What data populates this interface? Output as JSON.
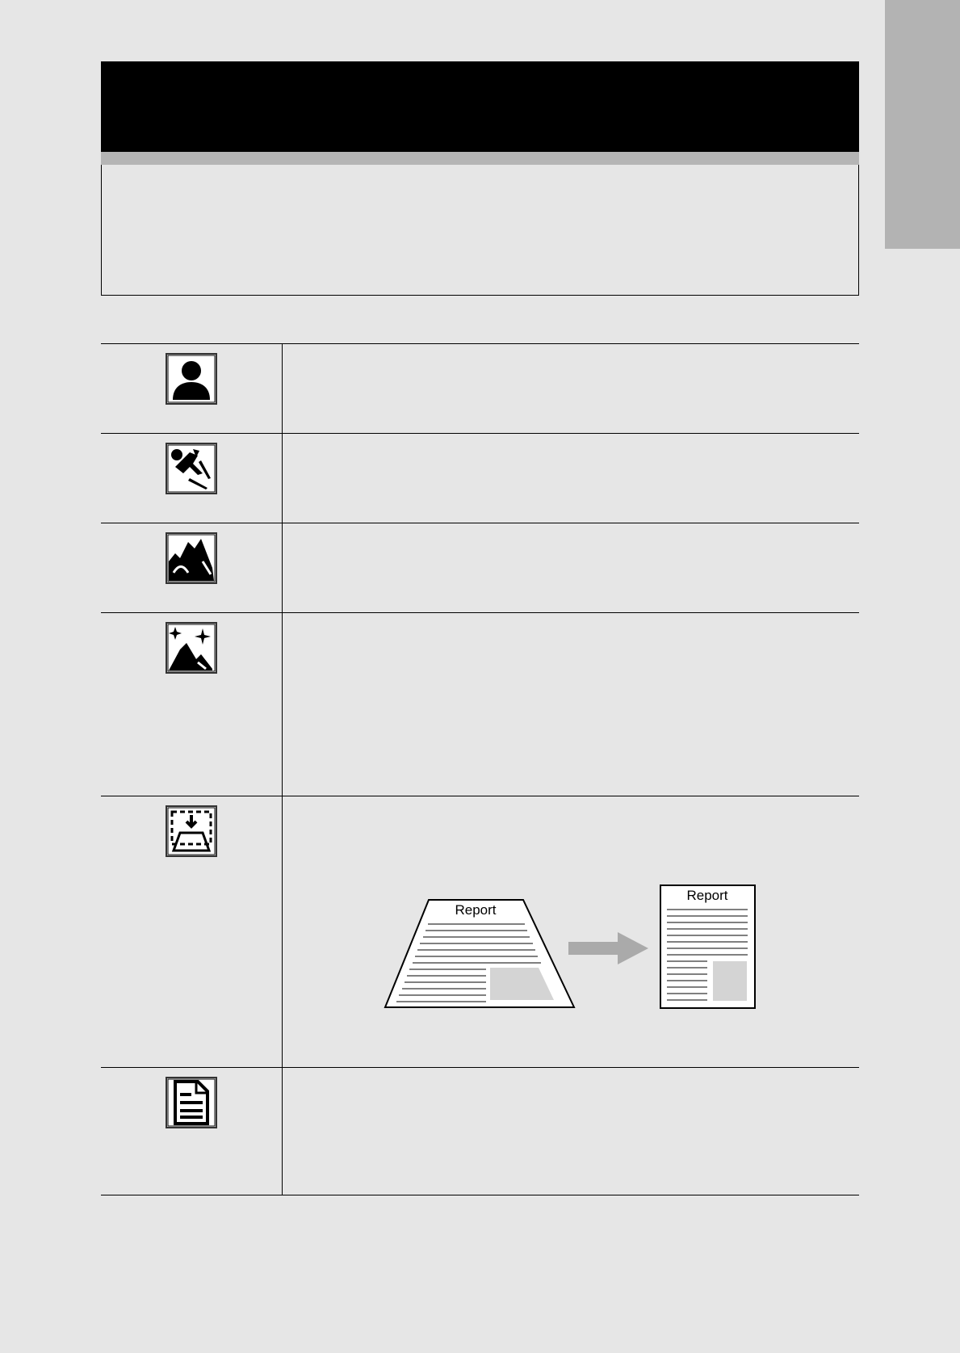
{
  "page": {
    "background": "#e6e6e6",
    "side_tab_color": "#b3b3b3",
    "header_color": "#000000",
    "stripe_color": "#b5b5b5"
  },
  "modes": [
    {
      "icon": "portrait-icon"
    },
    {
      "icon": "sports-icon"
    },
    {
      "icon": "landscape-icon"
    },
    {
      "icon": "night-landscape-icon"
    },
    {
      "icon": "keystone-correction-icon"
    },
    {
      "icon": "document-icon"
    }
  ],
  "illustration": {
    "before_label": "Report",
    "after_label": "Report",
    "arrow_color": "#aaaaaa"
  }
}
